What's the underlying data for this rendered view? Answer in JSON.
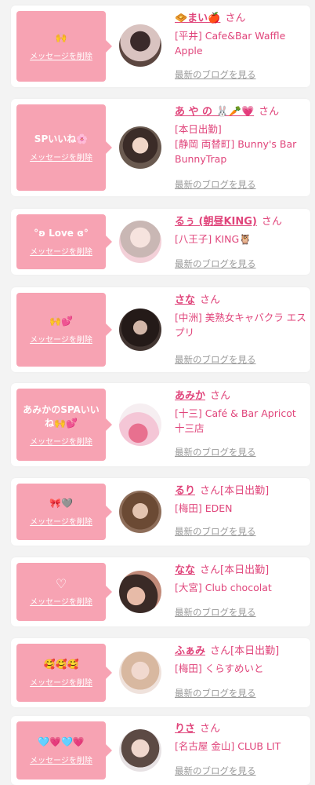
{
  "delete_label": "メッセージを削除",
  "blog_label": "最新のブログを見る",
  "san": "さん",
  "items": [
    {
      "message": "🙌",
      "name": "🧇まい🍎",
      "shop1": "[平井] Cafe&Bar Waffle Apple",
      "shop2": "",
      "status": ""
    },
    {
      "message": "SPいいね🌸",
      "name": "あ や の 🐰🥕💗",
      "shop1": "[本日出勤]",
      "shop2": "[静岡 両替町] Bunny's Bar BunnyTrap",
      "status": ""
    },
    {
      "message": "°ʚ Love ɞ°",
      "name": "るぅ (朝昼KING)",
      "shop1": "[八王子] KING🦉",
      "shop2": "",
      "status": ""
    },
    {
      "message": "🙌💕",
      "name": "さな",
      "shop1": "[中洲] 美熟女キャバクラ エスプリ",
      "shop2": "",
      "status": ""
    },
    {
      "message": "あみかのSPAいいね🙌💕",
      "name": "あみか",
      "shop1": "[十三] Café & Bar Apricot 十三店",
      "shop2": "",
      "status": ""
    },
    {
      "message": "🎀🩶",
      "name": "るり",
      "shop1": "[梅田] EDEN",
      "shop2": "",
      "status": "[本日出勤]"
    },
    {
      "message": "♡",
      "name": "なな",
      "shop1": "[大宮] Club chocolat",
      "shop2": "",
      "status": "[本日出勤]"
    },
    {
      "message": "🥰🥰🥰",
      "name": "ふぁみ",
      "shop1": "[梅田] くらすめいと",
      "shop2": "",
      "status": "[本日出勤]"
    },
    {
      "message": "🩵💗🩵💗",
      "name": "りさ",
      "shop1": "[名古屋 金山] CLUB LIT",
      "shop2": "",
      "status": ""
    }
  ],
  "colors": {
    "accent": "#e0457b",
    "bubble": "#f7a3b3",
    "link_gray": "#9a9a9a"
  }
}
